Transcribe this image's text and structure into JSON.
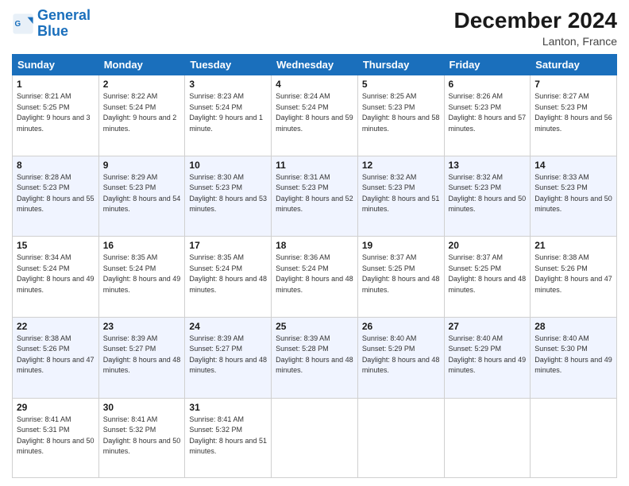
{
  "header": {
    "logo_line1": "General",
    "logo_line2": "Blue",
    "month_title": "December 2024",
    "location": "Lanton, France"
  },
  "weekdays": [
    "Sunday",
    "Monday",
    "Tuesday",
    "Wednesday",
    "Thursday",
    "Friday",
    "Saturday"
  ],
  "weeks": [
    [
      {
        "day": "1",
        "sunrise": "8:21 AM",
        "sunset": "5:25 PM",
        "daylight": "9 hours and 3 minutes."
      },
      {
        "day": "2",
        "sunrise": "8:22 AM",
        "sunset": "5:24 PM",
        "daylight": "9 hours and 2 minutes."
      },
      {
        "day": "3",
        "sunrise": "8:23 AM",
        "sunset": "5:24 PM",
        "daylight": "9 hours and 1 minute."
      },
      {
        "day": "4",
        "sunrise": "8:24 AM",
        "sunset": "5:24 PM",
        "daylight": "8 hours and 59 minutes."
      },
      {
        "day": "5",
        "sunrise": "8:25 AM",
        "sunset": "5:23 PM",
        "daylight": "8 hours and 58 minutes."
      },
      {
        "day": "6",
        "sunrise": "8:26 AM",
        "sunset": "5:23 PM",
        "daylight": "8 hours and 57 minutes."
      },
      {
        "day": "7",
        "sunrise": "8:27 AM",
        "sunset": "5:23 PM",
        "daylight": "8 hours and 56 minutes."
      }
    ],
    [
      {
        "day": "8",
        "sunrise": "8:28 AM",
        "sunset": "5:23 PM",
        "daylight": "8 hours and 55 minutes."
      },
      {
        "day": "9",
        "sunrise": "8:29 AM",
        "sunset": "5:23 PM",
        "daylight": "8 hours and 54 minutes."
      },
      {
        "day": "10",
        "sunrise": "8:30 AM",
        "sunset": "5:23 PM",
        "daylight": "8 hours and 53 minutes."
      },
      {
        "day": "11",
        "sunrise": "8:31 AM",
        "sunset": "5:23 PM",
        "daylight": "8 hours and 52 minutes."
      },
      {
        "day": "12",
        "sunrise": "8:32 AM",
        "sunset": "5:23 PM",
        "daylight": "8 hours and 51 minutes."
      },
      {
        "day": "13",
        "sunrise": "8:32 AM",
        "sunset": "5:23 PM",
        "daylight": "8 hours and 50 minutes."
      },
      {
        "day": "14",
        "sunrise": "8:33 AM",
        "sunset": "5:23 PM",
        "daylight": "8 hours and 50 minutes."
      }
    ],
    [
      {
        "day": "15",
        "sunrise": "8:34 AM",
        "sunset": "5:24 PM",
        "daylight": "8 hours and 49 minutes."
      },
      {
        "day": "16",
        "sunrise": "8:35 AM",
        "sunset": "5:24 PM",
        "daylight": "8 hours and 49 minutes."
      },
      {
        "day": "17",
        "sunrise": "8:35 AM",
        "sunset": "5:24 PM",
        "daylight": "8 hours and 48 minutes."
      },
      {
        "day": "18",
        "sunrise": "8:36 AM",
        "sunset": "5:24 PM",
        "daylight": "8 hours and 48 minutes."
      },
      {
        "day": "19",
        "sunrise": "8:37 AM",
        "sunset": "5:25 PM",
        "daylight": "8 hours and 48 minutes."
      },
      {
        "day": "20",
        "sunrise": "8:37 AM",
        "sunset": "5:25 PM",
        "daylight": "8 hours and 48 minutes."
      },
      {
        "day": "21",
        "sunrise": "8:38 AM",
        "sunset": "5:26 PM",
        "daylight": "8 hours and 47 minutes."
      }
    ],
    [
      {
        "day": "22",
        "sunrise": "8:38 AM",
        "sunset": "5:26 PM",
        "daylight": "8 hours and 47 minutes."
      },
      {
        "day": "23",
        "sunrise": "8:39 AM",
        "sunset": "5:27 PM",
        "daylight": "8 hours and 48 minutes."
      },
      {
        "day": "24",
        "sunrise": "8:39 AM",
        "sunset": "5:27 PM",
        "daylight": "8 hours and 48 minutes."
      },
      {
        "day": "25",
        "sunrise": "8:39 AM",
        "sunset": "5:28 PM",
        "daylight": "8 hours and 48 minutes."
      },
      {
        "day": "26",
        "sunrise": "8:40 AM",
        "sunset": "5:29 PM",
        "daylight": "8 hours and 48 minutes."
      },
      {
        "day": "27",
        "sunrise": "8:40 AM",
        "sunset": "5:29 PM",
        "daylight": "8 hours and 49 minutes."
      },
      {
        "day": "28",
        "sunrise": "8:40 AM",
        "sunset": "5:30 PM",
        "daylight": "8 hours and 49 minutes."
      }
    ],
    [
      {
        "day": "29",
        "sunrise": "8:41 AM",
        "sunset": "5:31 PM",
        "daylight": "8 hours and 50 minutes."
      },
      {
        "day": "30",
        "sunrise": "8:41 AM",
        "sunset": "5:32 PM",
        "daylight": "8 hours and 50 minutes."
      },
      {
        "day": "31",
        "sunrise": "8:41 AM",
        "sunset": "5:32 PM",
        "daylight": "8 hours and 51 minutes."
      },
      null,
      null,
      null,
      null
    ]
  ]
}
